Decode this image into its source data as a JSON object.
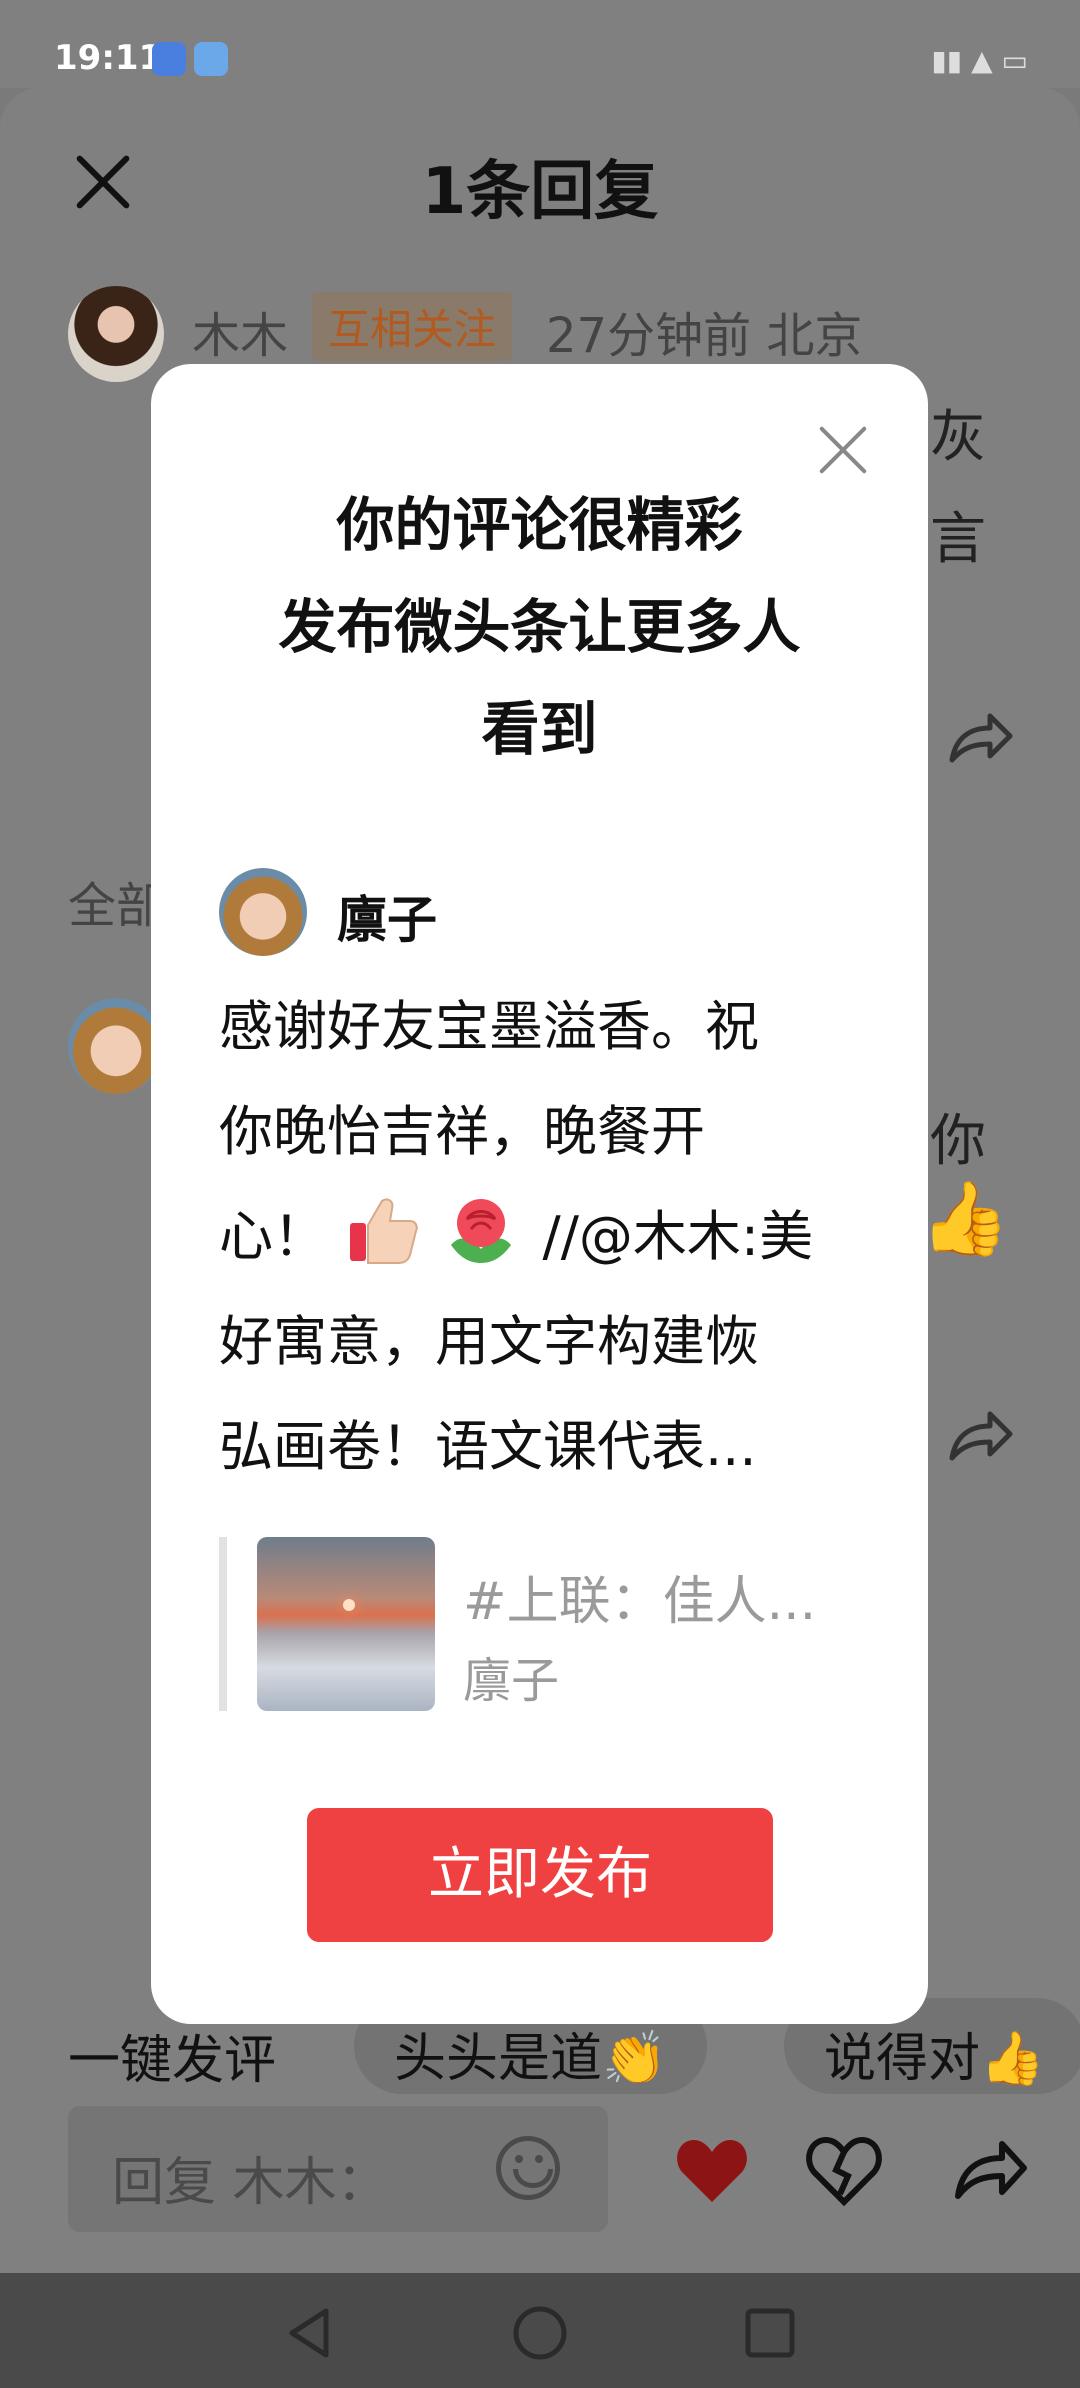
{
  "status_bar": {
    "time": "19:11"
  },
  "sheet": {
    "title": "1条回复",
    "comment": {
      "user": "木木",
      "badge": "互相关注",
      "meta": "27分钟前  北京",
      "text_fragments": [
        "灰",
        "言"
      ]
    },
    "section_label": "全部",
    "reply_fragments": [
      "你"
    ],
    "quick_label": "一键发评",
    "chips": [
      "头头是道👏",
      "说得对👍"
    ],
    "reply_placeholder": "回复 木木："
  },
  "modal": {
    "title_lines": [
      "你的评论很精彩",
      "发布微头条让更多人",
      "看到"
    ],
    "author": "廪子",
    "body_lines": [
      "感谢好友宝墨溢香。祝",
      "你晚怡吉祥，晚餐开",
      "心！",
      "//@木木:美",
      "好寓意，用文字构建恢",
      "弘画卷！语文课代表..."
    ],
    "quote": {
      "title": "#上联：佳人...",
      "author": "廪子"
    },
    "publish_label": "立即发布"
  },
  "colors": {
    "accent": "#f04142",
    "overlay": "#808080",
    "like": "#d81e1e"
  }
}
